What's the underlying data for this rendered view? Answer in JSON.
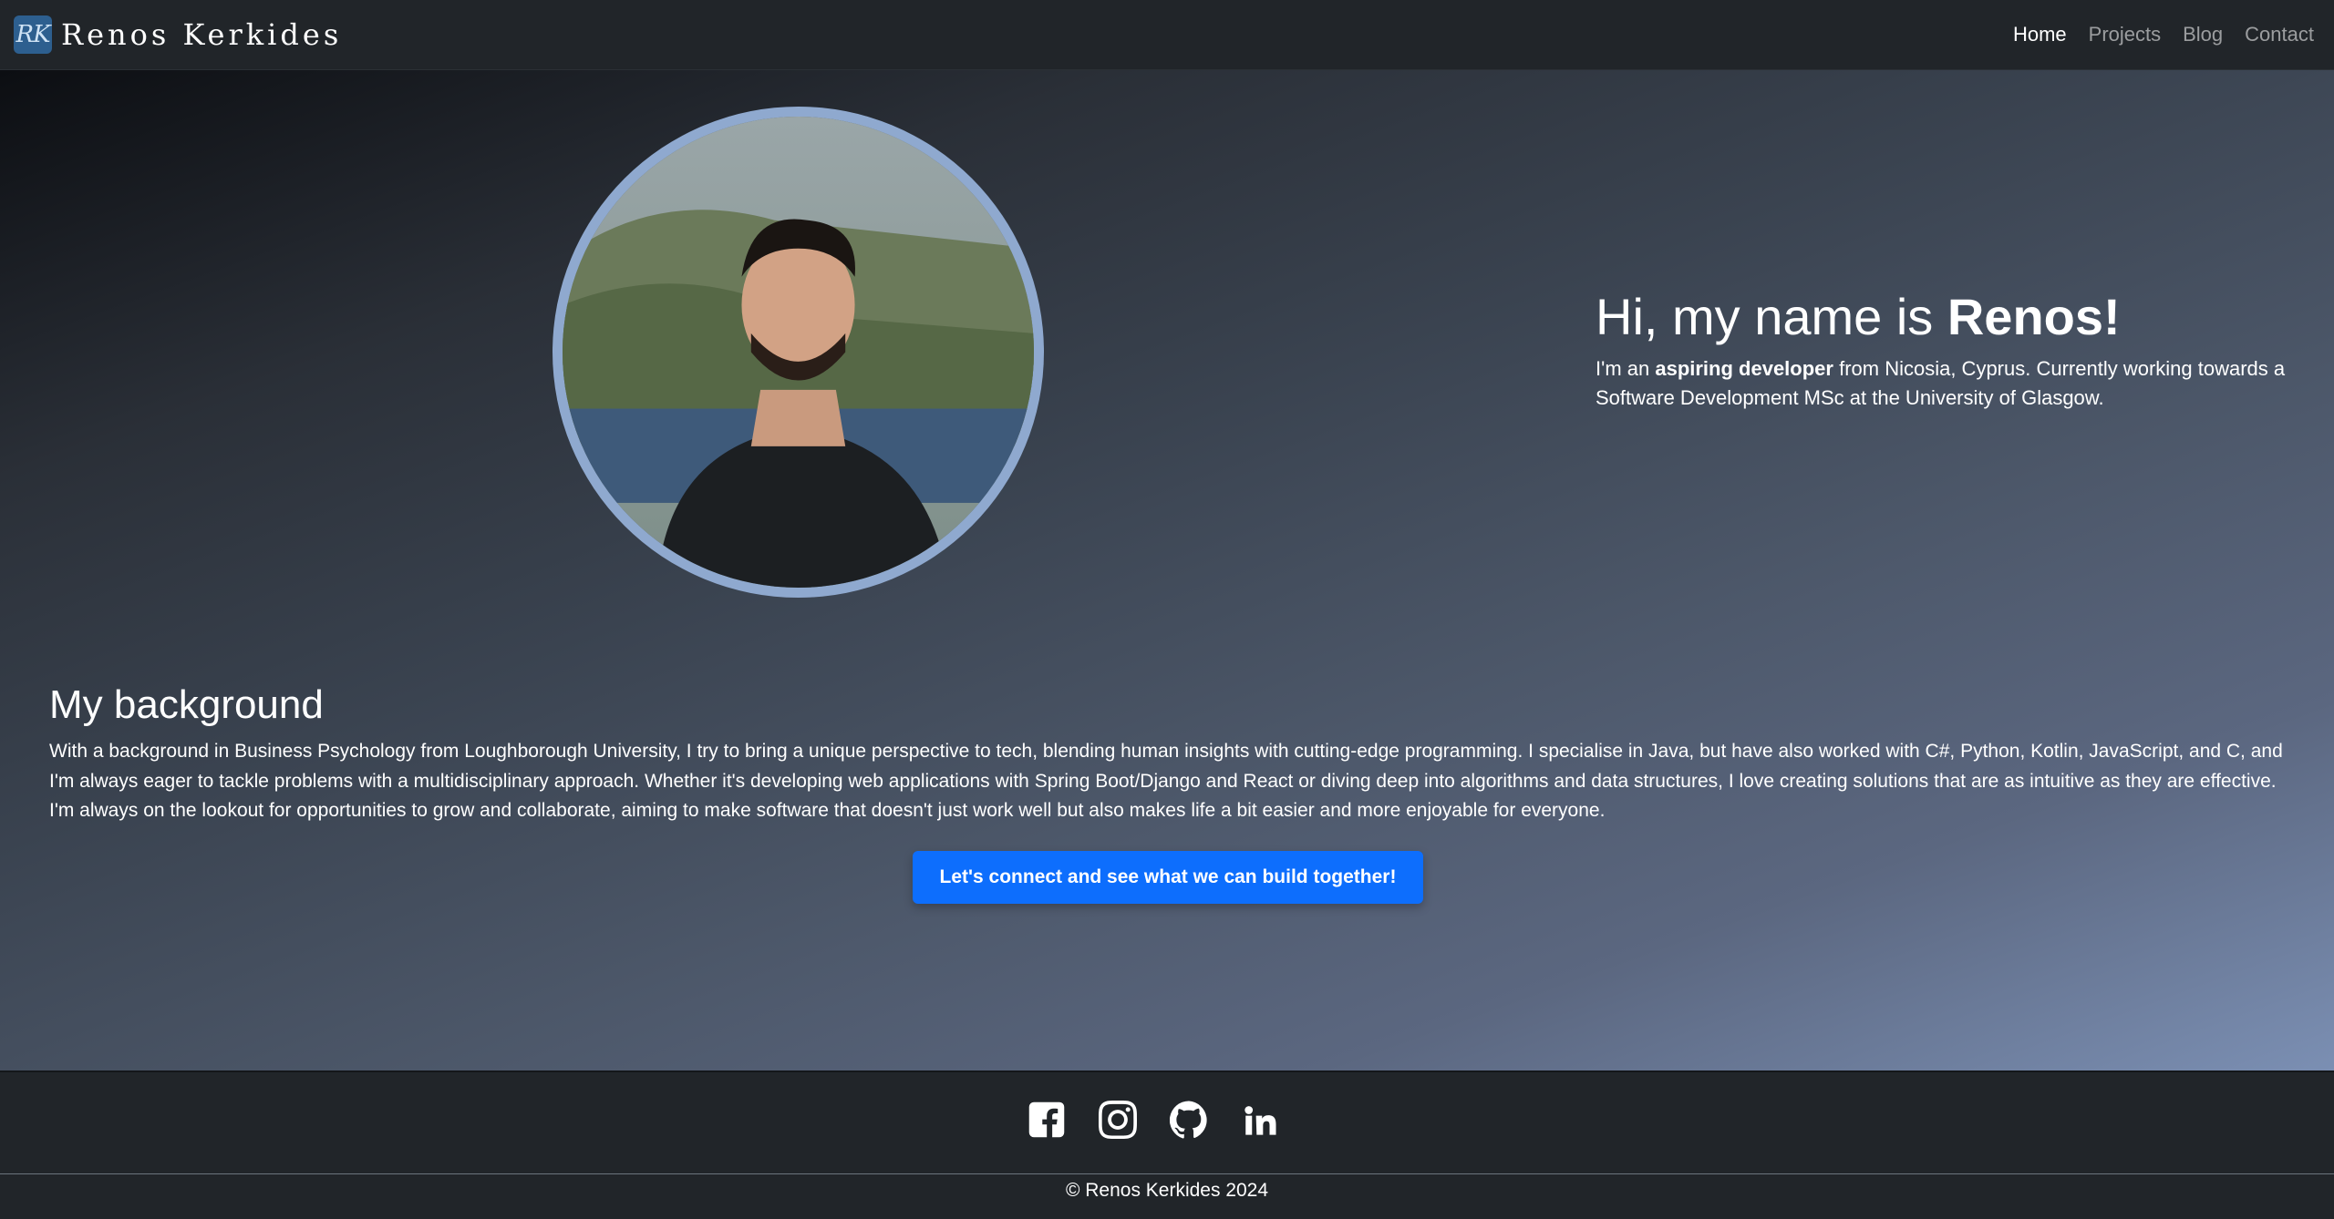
{
  "navbar": {
    "logo_text": "RK",
    "brand": "Renos Kerkides",
    "links": [
      {
        "label": "Home",
        "active": true
      },
      {
        "label": "Projects",
        "active": false
      },
      {
        "label": "Blog",
        "active": false
      },
      {
        "label": "Contact",
        "active": false
      }
    ]
  },
  "hero": {
    "greeting_prefix": "Hi, my name is ",
    "greeting_name": "Renos!",
    "intro_prefix": "I'm an ",
    "intro_bold": "aspiring developer",
    "intro_suffix": " from Nicosia, Cyprus. Currently working towards a Software Development MSc at the University of Glasgow."
  },
  "background": {
    "heading": "My background",
    "text": "With a background in Business Psychology from Loughborough University, I try to bring a unique perspective to tech, blending human insights with cutting-edge programming. I specialise in Java, but have also worked with C#, Python, Kotlin, JavaScript, and C, and I'm always eager to tackle problems with a multidisciplinary approach. Whether it's developing web applications with Spring Boot/Django and React or diving deep into algorithms and data structures, I love creating solutions that are as intuitive as they are effective. I'm always on the lookout for opportunities to grow and collaborate, aiming to make software that doesn't just work well but also makes life a bit easier and more enjoyable for everyone.",
    "cta_label": "Let's connect and see what we can build together!"
  },
  "footer": {
    "socials": [
      "facebook-icon",
      "instagram-icon",
      "github-icon",
      "linkedin-icon"
    ],
    "copyright": "© Renos Kerkides 2024"
  },
  "colors": {
    "navbar_bg": "#212529",
    "accent": "#0d6efd",
    "avatar_ring": "#8fa9cf"
  }
}
